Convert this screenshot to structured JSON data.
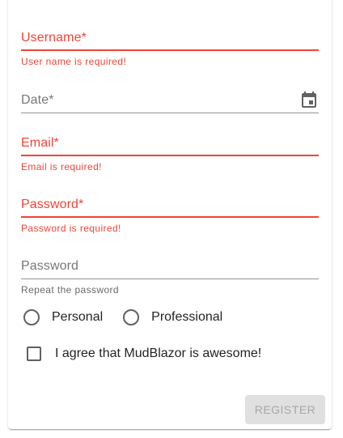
{
  "form": {
    "username": {
      "label": "Username*",
      "value": "",
      "helper": "User name is required!",
      "error": true
    },
    "date": {
      "label": "Date*",
      "value": "",
      "icon": "calendar-icon"
    },
    "email": {
      "label": "Email*",
      "value": "",
      "helper": "Email is required!",
      "error": true
    },
    "password": {
      "label": "Password*",
      "value": "",
      "helper": "Password is required!",
      "error": true
    },
    "repeat_password": {
      "label": "Password",
      "value": "",
      "helper": "Repeat the password"
    },
    "account_type": {
      "options": [
        "Personal",
        "Professional"
      ],
      "selected": null
    },
    "agree": {
      "label": "I agree that MudBlazor is awesome!",
      "checked": false
    },
    "register_label": "Register"
  },
  "colors": {
    "error": "#f44336",
    "disabled_bg": "#e0e0e0",
    "control": "#616161"
  }
}
